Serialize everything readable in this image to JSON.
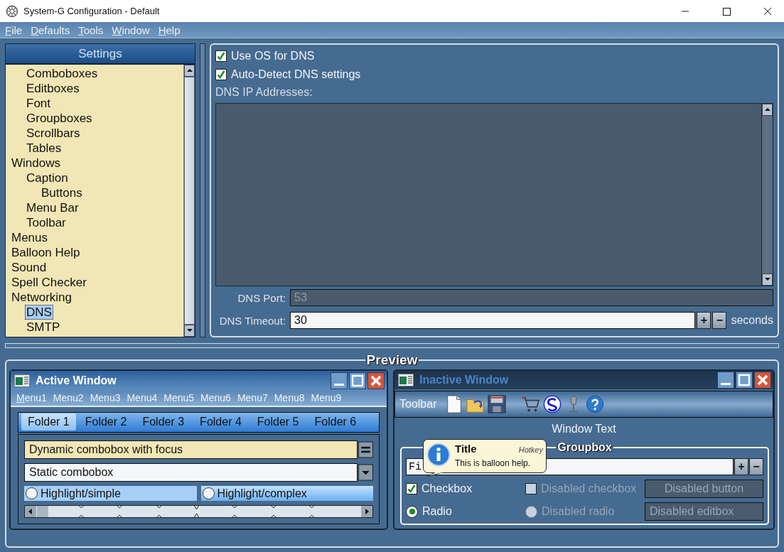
{
  "window": {
    "title": "System-G Configuration - Default"
  },
  "menu_bar": [
    {
      "label": "File",
      "mnemonic": true
    },
    {
      "label": "Defaults",
      "mnemonic": true
    },
    {
      "label": "Tools",
      "mnemonic": true
    },
    {
      "label": "Window",
      "mnemonic": true
    },
    {
      "label": "Help",
      "mnemonic": true
    }
  ],
  "settings": {
    "title": "Settings",
    "tree": [
      {
        "children": [
          {
            "label": "Comboboxes",
            "selected": false
          },
          {
            "label": "Editboxes",
            "selected": false
          },
          {
            "label": "Font",
            "selected": false
          },
          {
            "label": "Groupboxes",
            "selected": false
          },
          {
            "label": "Scrollbars",
            "selected": false
          },
          {
            "label": "Tables",
            "selected": false
          }
        ]
      },
      {
        "label": "Windows",
        "selected": false,
        "children": [
          {
            "label": "Caption",
            "selected": false,
            "children": [
              {
                "label": "Buttons",
                "selected": false
              }
            ]
          },
          {
            "label": "Menu Bar",
            "selected": false
          },
          {
            "label": "Toolbar",
            "selected": false
          }
        ]
      },
      {
        "label": "Menus",
        "selected": false
      },
      {
        "label": "Balloon Help",
        "selected": false
      },
      {
        "label": "Sound",
        "selected": false
      },
      {
        "label": "Spell Checker",
        "selected": false
      },
      {
        "label": "Networking",
        "selected": false,
        "children": [
          {
            "label": "DNS",
            "selected": true
          },
          {
            "label": "SMTP",
            "selected": false
          }
        ]
      }
    ]
  },
  "dns": {
    "options": [
      {
        "label": "Use OS for DNS",
        "checked": true
      },
      {
        "label": "Auto-Detect DNS settings",
        "checked": true
      }
    ],
    "addresses_label": "DNS IP Addresses:",
    "port": {
      "label": "DNS Port:",
      "value": "53",
      "disabled": true
    },
    "timeout": {
      "label": "DNS Timeout:",
      "value": "30",
      "disabled": false,
      "spin": [
        "+",
        "−"
      ],
      "unit": "seconds"
    }
  },
  "preview": {
    "title": "Preview",
    "active_window": {
      "title": "Active Window",
      "active": true,
      "menus": [
        {
          "label": "Menu1",
          "mnemonic": true
        },
        {
          "label": "Menu2",
          "mnemonic": false
        },
        {
          "label": "Menu3",
          "mnemonic": false
        },
        {
          "label": "Menu4",
          "mnemonic": false
        },
        {
          "label": "Menu5",
          "mnemonic": false
        },
        {
          "label": "Menu6",
          "mnemonic": false
        },
        {
          "label": "Menu7",
          "mnemonic": false
        },
        {
          "label": "Menu8",
          "mnemonic": false
        },
        {
          "label": "Menu9",
          "mnemonic": false
        }
      ],
      "tabs": [
        {
          "label": "Folder 1",
          "selected": true
        },
        {
          "label": "Folder 2",
          "selected": false
        },
        {
          "label": "Folder 3",
          "selected": false
        },
        {
          "label": "Folder 4",
          "selected": false
        },
        {
          "label": "Folder 5",
          "selected": false
        },
        {
          "label": "Folder 6",
          "selected": false
        }
      ],
      "combos": [
        {
          "kind": "dynamic",
          "value": "Dynamic combobox with focus",
          "focused": true
        },
        {
          "kind": "static",
          "value": "Static combobox",
          "focused": false
        }
      ],
      "radios": [
        {
          "label": "Highlight/simple",
          "kind": "simple",
          "checked": false
        },
        {
          "label": "Highlight/complex",
          "kind": "complex",
          "checked": false
        }
      ]
    },
    "inactive_window": {
      "title": "Inactive Window",
      "active": false,
      "toolbar_label": "Toolbar",
      "window_text": "Window Text",
      "groupbox": {
        "title": "Groupbox",
        "field_value": "Fi",
        "spin": [
          "+",
          "−"
        ],
        "controls": [
          {
            "kind": "checkbox",
            "label": "Checkbox",
            "checked": true,
            "disabled": false
          },
          {
            "kind": "checkbox",
            "label": "Disabled checkbox",
            "checked": false,
            "disabled": true
          },
          {
            "kind": "button",
            "label": "Disabled button",
            "disabled": true
          },
          {
            "kind": "radio",
            "label": "Radio",
            "checked": true,
            "disabled": false
          },
          {
            "kind": "radio",
            "label": "Disabled radio",
            "checked": false,
            "disabled": true
          },
          {
            "kind": "editbox",
            "value": "Disabled editbox",
            "disabled": true
          }
        ]
      },
      "balloon": {
        "title": "Title",
        "hotkey": "Hotkey",
        "text": "This is balloon help."
      }
    }
  }
}
